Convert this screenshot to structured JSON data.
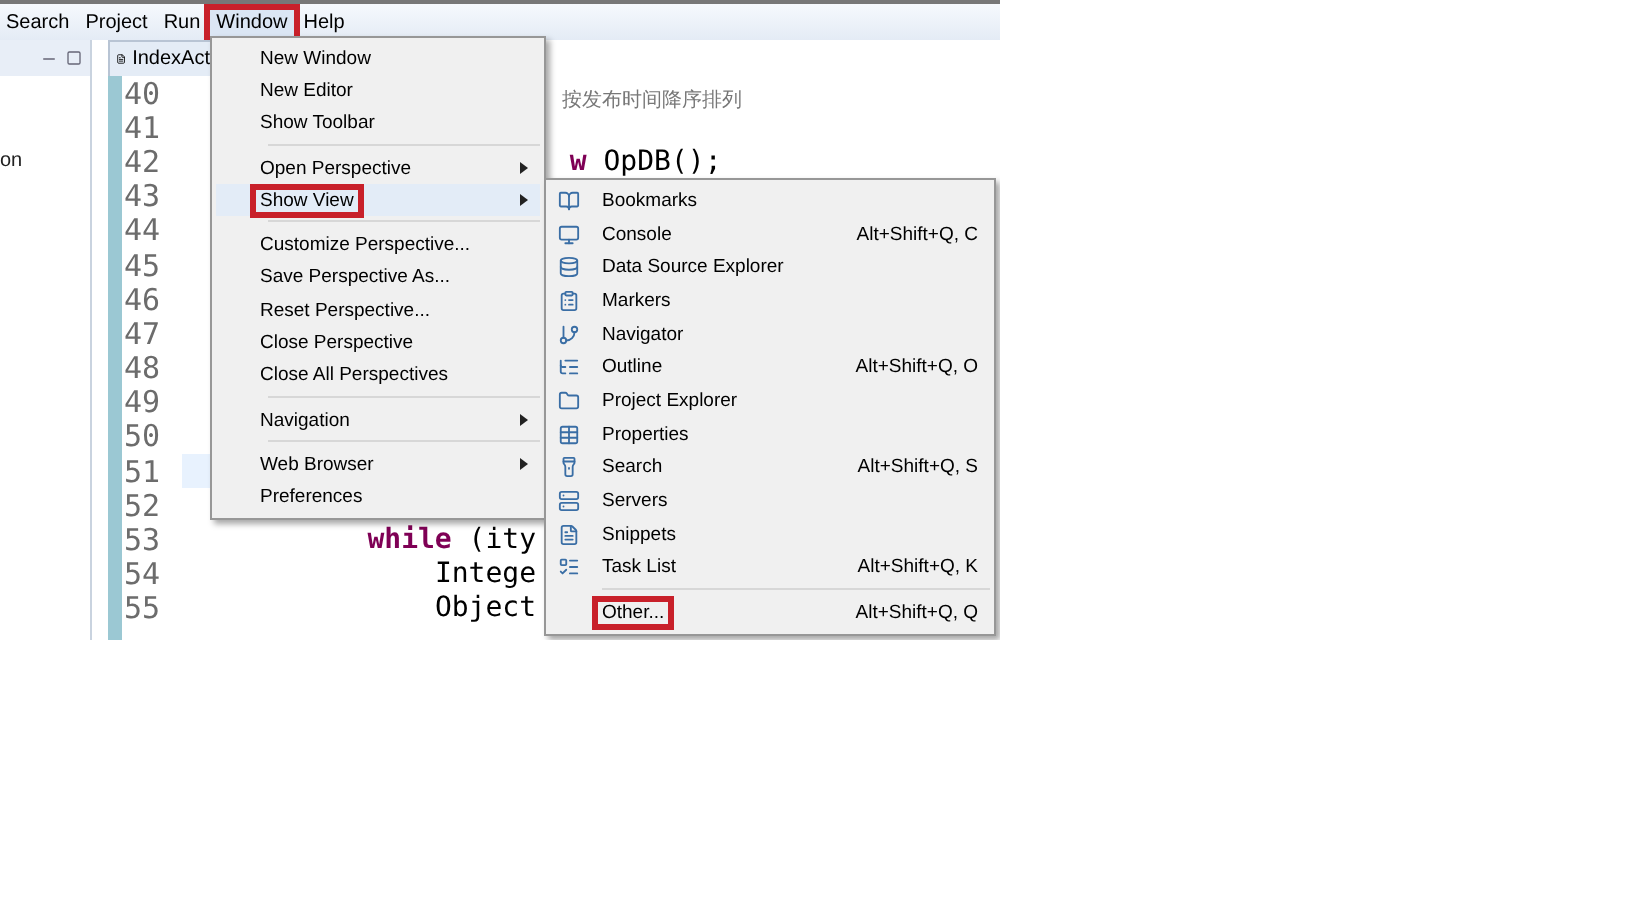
{
  "menubar": [
    {
      "label": "Search",
      "selected": false,
      "highlighted": false
    },
    {
      "label": "Project",
      "selected": false,
      "highlighted": false
    },
    {
      "label": "Run",
      "selected": false,
      "highlighted": false
    },
    {
      "label": "Window",
      "selected": true,
      "highlighted": true
    },
    {
      "label": "Help",
      "selected": false,
      "highlighted": false
    }
  ],
  "left_panel": {
    "item": "on"
  },
  "editor": {
    "tab": "IndexAct",
    "lines": [
      {
        "number": "40",
        "kind": "comment",
        "text": "按发布时间降序排列",
        "current": false
      },
      {
        "number": "41",
        "kind": "code",
        "current": false
      },
      {
        "number": "42",
        "kind": "code",
        "text": "                       **w** OpDB();",
        "current": false
      },
      {
        "number": "43",
        "kind": "code",
        "current": false
      },
      {
        "number": "44",
        "kind": "code",
        "current": false
      },
      {
        "number": "45",
        "kind": "code",
        "current": false
      },
      {
        "number": "46",
        "kind": "code",
        "current": false
      },
      {
        "number": "47",
        "kind": "code",
        "current": false
      },
      {
        "number": "48",
        "kind": "code",
        "current": false
      },
      {
        "number": "49",
        "kind": "code",
        "current": false
      },
      {
        "number": "50",
        "kind": "code",
        "current": false
      },
      {
        "number": "51",
        "kind": "code",
        "current": true
      },
      {
        "number": "52",
        "kind": "code",
        "current": false
      },
      {
        "number": "53",
        "kind": "code",
        "text": "           **while** (ity",
        "current": false
      },
      {
        "number": "54",
        "kind": "code",
        "text": "               Intege",
        "current": false
      },
      {
        "number": "55",
        "kind": "code",
        "text": "               Object",
        "current": false
      }
    ]
  },
  "window_menu": {
    "groups": [
      [
        {
          "label": "New Window",
          "submenu": false,
          "highlighted": false,
          "selected": false
        },
        {
          "label": "New Editor",
          "submenu": false,
          "highlighted": false,
          "selected": false
        },
        {
          "label": "Show Toolbar",
          "submenu": false,
          "highlighted": false,
          "selected": false
        }
      ],
      [
        {
          "label": "Open Perspective",
          "submenu": true,
          "highlighted": false,
          "selected": false
        },
        {
          "label": "Show View",
          "submenu": true,
          "highlighted": true,
          "selected": true
        }
      ],
      [
        {
          "label": "Customize Perspective...",
          "submenu": false,
          "highlighted": false,
          "selected": false
        },
        {
          "label": "Save Perspective As...",
          "submenu": false,
          "highlighted": false,
          "selected": false
        },
        {
          "label": "Reset Perspective...",
          "submenu": false,
          "highlighted": false,
          "selected": false
        },
        {
          "label": "Close Perspective",
          "submenu": false,
          "highlighted": false,
          "selected": false
        },
        {
          "label": "Close All Perspectives",
          "submenu": false,
          "highlighted": false,
          "selected": false
        }
      ],
      [
        {
          "label": "Navigation",
          "submenu": true,
          "highlighted": false,
          "selected": false
        }
      ],
      [
        {
          "label": "Web Browser",
          "submenu": true,
          "highlighted": false,
          "selected": false
        },
        {
          "label": "Preferences",
          "submenu": false,
          "highlighted": false,
          "selected": false
        }
      ]
    ]
  },
  "show_view_menu": {
    "groups": [
      [
        {
          "label": "Bookmarks",
          "highlighted": false
        },
        {
          "label": "Console",
          "shortcut": "Alt+Shift+Q, C",
          "highlighted": false
        },
        {
          "label": "Data Source Explorer",
          "highlighted": false
        },
        {
          "label": "Markers",
          "highlighted": false
        },
        {
          "label": "Navigator",
          "highlighted": false
        },
        {
          "label": "Outline",
          "shortcut": "Alt+Shift+Q, O",
          "highlighted": false
        },
        {
          "label": "Project Explorer",
          "highlighted": false
        },
        {
          "label": "Properties",
          "highlighted": false
        },
        {
          "label": "Search",
          "shortcut": "Alt+Shift+Q, S",
          "highlighted": false
        },
        {
          "label": "Servers",
          "highlighted": false
        },
        {
          "label": "Snippets",
          "highlighted": false
        },
        {
          "label": "Task List",
          "shortcut": "Alt+Shift+Q, K",
          "highlighted": false
        }
      ],
      [
        {
          "label": "Other...",
          "shortcut": "Alt+Shift+Q, Q",
          "highlighted": true
        }
      ]
    ]
  }
}
